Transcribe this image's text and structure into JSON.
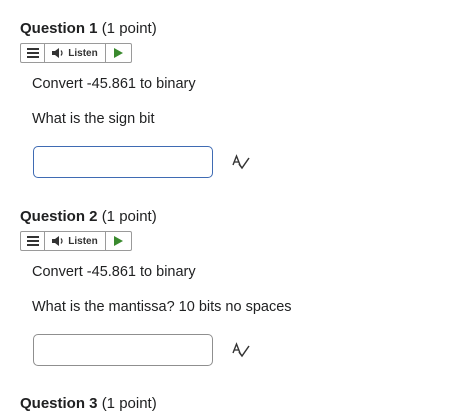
{
  "questions": [
    {
      "title": "Question 1",
      "points": "(1 point)",
      "listen_label": "Listen",
      "prompt": "Convert -45.861 to binary",
      "sub_prompt": "What is the sign bit",
      "answer_value": ""
    },
    {
      "title": "Question 2",
      "points": "(1 point)",
      "listen_label": "Listen",
      "prompt": "Convert -45.861 to binary",
      "sub_prompt": "What is the mantissa? 10 bits no spaces",
      "answer_value": ""
    },
    {
      "title": "Question 3",
      "points": "(1 point)"
    }
  ],
  "icons": {
    "menu": "menu-icon",
    "speaker": "speaker-icon",
    "play": "play-icon",
    "spell_check": "spell-check-icon"
  },
  "colors": {
    "play_green": "#3a8a2e",
    "focus_border": "#3f6bb3",
    "input_border": "#8f8f8f"
  }
}
